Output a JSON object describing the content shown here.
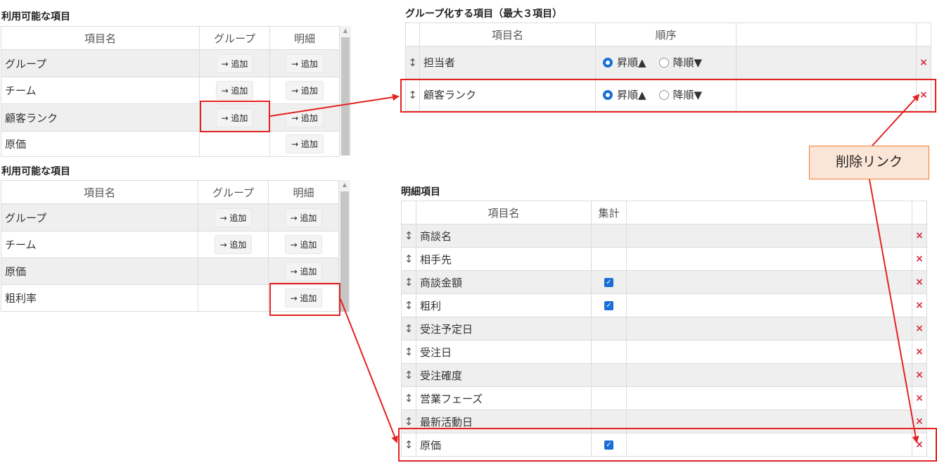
{
  "available1": {
    "heading": "利用可能な項目",
    "headers": [
      "項目名",
      "グループ",
      "明細"
    ],
    "rows": [
      {
        "name": "グループ",
        "group_btn": "→ 追加",
        "detail_btn": "→ 追加"
      },
      {
        "name": "チーム",
        "group_btn": "→ 追加",
        "detail_btn": "→ 追加"
      },
      {
        "name": "顧客ランク",
        "group_btn": "→ 追加",
        "detail_btn": "→ 追加"
      },
      {
        "name": "原価",
        "group_btn": "",
        "detail_btn": "→ 追加"
      }
    ]
  },
  "available2": {
    "heading": "利用可能な項目",
    "headers": [
      "項目名",
      "グループ",
      "明細"
    ],
    "rows": [
      {
        "name": "グループ",
        "group_btn": "→ 追加",
        "detail_btn": "→ 追加"
      },
      {
        "name": "チーム",
        "group_btn": "→ 追加",
        "detail_btn": "→ 追加"
      },
      {
        "name": "原価",
        "group_btn": "",
        "detail_btn": "→ 追加"
      },
      {
        "name": "粗利率",
        "group_btn": "",
        "detail_btn": "→ 追加"
      }
    ]
  },
  "grouping": {
    "heading": "グループ化する項目（最大３項目）",
    "headers": [
      "項目名",
      "順序"
    ],
    "asc_label": "昇順▲",
    "desc_label": "降順▼",
    "rows": [
      {
        "name": "担当者",
        "order": "asc"
      },
      {
        "name": "顧客ランク",
        "order": "asc"
      }
    ]
  },
  "details": {
    "heading": "明細項目",
    "headers": [
      "項目名",
      "集計"
    ],
    "rows": [
      {
        "name": "商談名",
        "aggregate": false
      },
      {
        "name": "相手先",
        "aggregate": false
      },
      {
        "name": "商談金額",
        "aggregate": true
      },
      {
        "name": "粗利",
        "aggregate": true
      },
      {
        "name": "受注予定日",
        "aggregate": false
      },
      {
        "name": "受注日",
        "aggregate": false
      },
      {
        "name": "受注確度",
        "aggregate": false
      },
      {
        "name": "営業フェーズ",
        "aggregate": false
      },
      {
        "name": "最新活動日",
        "aggregate": false
      },
      {
        "name": "原価",
        "aggregate": true
      }
    ]
  },
  "icons": {
    "drag": "↕",
    "delete": "×",
    "check": "✓"
  },
  "callout": {
    "label": "削除リンク"
  },
  "colors": {
    "highlight": "#e52222",
    "callout_fill": "#fbe5d6",
    "callout_border": "#ed7d31",
    "delete": "#d6293c",
    "accent": "#1a6fd6"
  }
}
